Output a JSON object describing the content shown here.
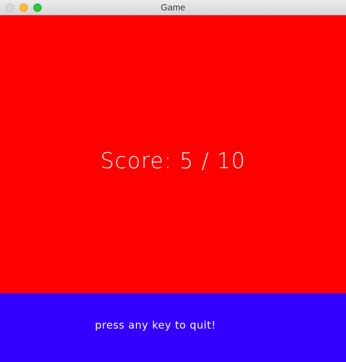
{
  "window": {
    "title": "Game"
  },
  "game": {
    "score_text": "Score: 5 / 10",
    "quit_prompt": "press any key to quit!"
  },
  "colors": {
    "game_background": "#ff0000",
    "footer_background": "#3300ff",
    "text": "#ffffff"
  }
}
